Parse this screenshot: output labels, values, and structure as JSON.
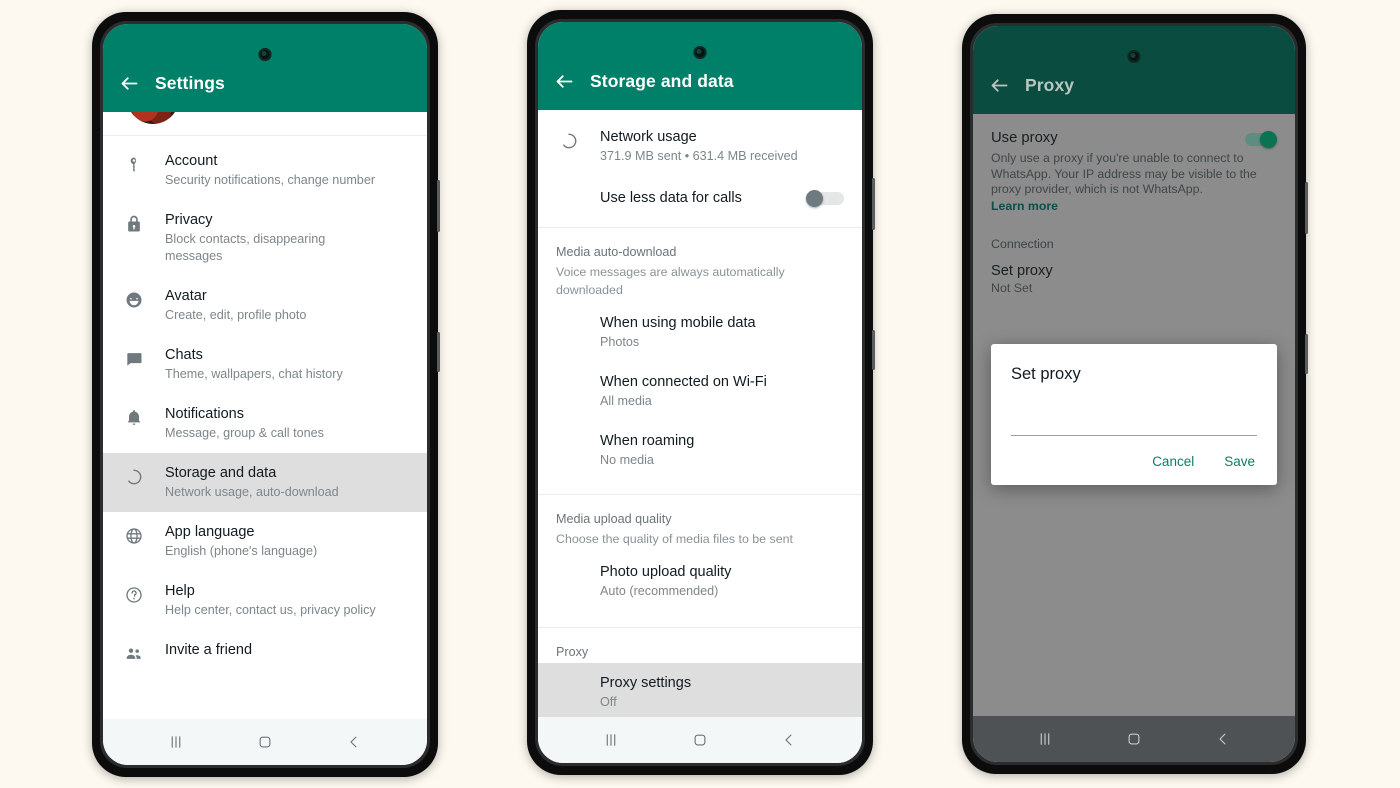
{
  "colors": {
    "brand_green": "#008069",
    "page_background": "#fdf9f0",
    "row_selected": "#dedede",
    "toggle_on": "#0a8f6b",
    "nav_bar": "#f4f7f8"
  },
  "phone1": {
    "appbar": {
      "title": "Settings",
      "back_icon": "arrow-left-icon"
    },
    "items": [
      {
        "icon": "key-icon",
        "title": "Account",
        "sub": "Security notifications, change number",
        "selected": false
      },
      {
        "icon": "lock-icon",
        "title": "Privacy",
        "sub": "Block contacts, disappearing messages",
        "selected": false
      },
      {
        "icon": "avatar-icon",
        "title": "Avatar",
        "sub": "Create, edit, profile photo",
        "selected": false
      },
      {
        "icon": "chats-icon",
        "title": "Chats",
        "sub": "Theme, wallpapers, chat history",
        "selected": false
      },
      {
        "icon": "bell-icon",
        "title": "Notifications",
        "sub": "Message, group & call tones",
        "selected": false
      },
      {
        "icon": "storage-icon",
        "title": "Storage and data",
        "sub": "Network usage, auto-download",
        "selected": true
      },
      {
        "icon": "globe-icon",
        "title": "App language",
        "sub": "English (phone's language)",
        "selected": false
      },
      {
        "icon": "help-icon",
        "title": "Help",
        "sub": "Help center, contact us, privacy policy",
        "selected": false
      },
      {
        "icon": "people-icon",
        "title": "Invite a friend",
        "sub": "",
        "selected": false
      }
    ],
    "navbar": {
      "recents": "recents-icon",
      "home": "home-icon",
      "back": "back-icon"
    }
  },
  "phone2": {
    "appbar": {
      "title": "Storage and data",
      "back_icon": "arrow-left-icon"
    },
    "network_usage": {
      "icon": "storage-icon",
      "title": "Network usage",
      "sub": "371.9 MB sent • 631.4 MB received"
    },
    "use_less_data": {
      "label": "Use less data for calls",
      "state": "off"
    },
    "media_auto_download": {
      "heading": "Media auto-download",
      "note": "Voice messages are always automatically downloaded",
      "items": [
        {
          "title": "When using mobile data",
          "sub": "Photos"
        },
        {
          "title": "When connected on Wi-Fi",
          "sub": "All media"
        },
        {
          "title": "When roaming",
          "sub": "No media"
        }
      ]
    },
    "media_upload_quality": {
      "heading": "Media upload quality",
      "note": "Choose the quality of media files to be sent",
      "items": [
        {
          "title": "Photo upload quality",
          "sub": "Auto (recommended)"
        }
      ]
    },
    "proxy": {
      "heading": "Proxy",
      "items": [
        {
          "title": "Proxy settings",
          "sub": "Off",
          "selected": true
        }
      ]
    },
    "navbar": {
      "recents": "recents-icon",
      "home": "home-icon",
      "back": "back-icon"
    }
  },
  "phone3": {
    "appbar": {
      "title": "Proxy",
      "back_icon": "arrow-left-icon"
    },
    "use_proxy": {
      "title": "Use proxy",
      "description": "Only use a proxy if you're unable to connect to WhatsApp. Your IP address may be visible to the proxy provider, which is not WhatsApp.",
      "link": "Learn more",
      "state": "on"
    },
    "connection": {
      "heading": "Connection",
      "title": "Set proxy",
      "sub": "Not Set"
    },
    "dialog": {
      "title": "Set proxy",
      "input_value": "",
      "input_placeholder": "",
      "cancel_label": "Cancel",
      "save_label": "Save"
    },
    "navbar": {
      "recents": "recents-icon",
      "home": "home-icon",
      "back": "back-icon"
    }
  }
}
